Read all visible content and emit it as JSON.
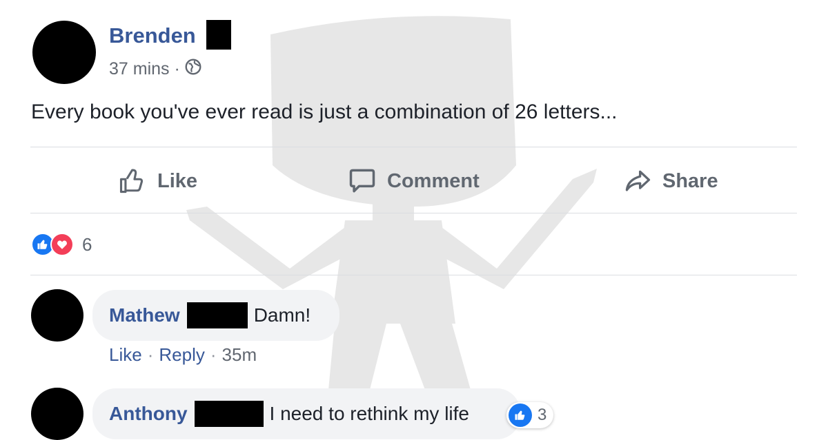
{
  "post": {
    "author": "Brenden",
    "time": "37 mins",
    "separator": "·",
    "text": "Every book you've ever read is just a combination of 26 letters..."
  },
  "actions": {
    "like": "Like",
    "comment": "Comment",
    "share": "Share"
  },
  "reactions": {
    "types": [
      "like",
      "love"
    ],
    "count": "6"
  },
  "comments": [
    {
      "author": "Mathew",
      "text": "Damn!",
      "actions": {
        "like": "Like",
        "reply": "Reply",
        "separator": "·",
        "time": "35m"
      }
    },
    {
      "author": "Anthony",
      "text": "I need to rethink my life",
      "reaction": {
        "type": "like",
        "count": "3"
      }
    }
  ],
  "icons": {
    "privacy": "globe-icon",
    "like": "thumbs-up-icon",
    "comment": "speech-bubble-icon",
    "share": "share-arrow-icon",
    "reaction_like": "like-reaction-icon",
    "reaction_love": "love-reaction-icon"
  },
  "colors": {
    "name_link": "#385898",
    "text": "#1d2129",
    "secondary": "#606770",
    "like_blue": "#1877f2",
    "love_red": "#f33e58",
    "bubble": "#f2f3f5",
    "divider": "#dadde1"
  }
}
